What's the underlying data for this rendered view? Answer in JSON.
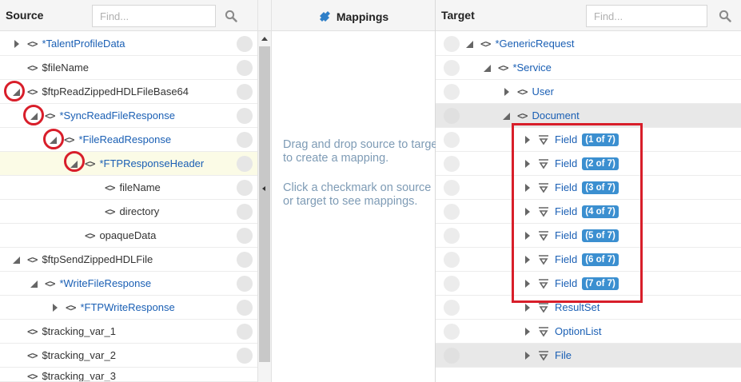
{
  "source": {
    "title": "Source",
    "find_placeholder": "Find...",
    "rows": [
      {
        "label": "TalentProfileData",
        "required": true,
        "expander": "right"
      },
      {
        "label": "$fileName",
        "required": false,
        "expander": "none"
      },
      {
        "label": "$ftpReadZippedHDLFileBase64",
        "required": false,
        "expander": "down"
      },
      {
        "label": "SyncReadFileResponse",
        "required": true,
        "expander": "down"
      },
      {
        "label": "FileReadResponse",
        "required": true,
        "expander": "down"
      },
      {
        "label": "FTPResponseHeader",
        "required": true,
        "expander": "down"
      },
      {
        "label": "fileName",
        "required": false,
        "expander": "none"
      },
      {
        "label": "directory",
        "required": false,
        "expander": "none"
      },
      {
        "label": "opaqueData",
        "required": false,
        "expander": "none"
      },
      {
        "label": "$ftpSendZippedHDLFile",
        "required": false,
        "expander": "down"
      },
      {
        "label": "WriteFileResponse",
        "required": true,
        "expander": "down"
      },
      {
        "label": "FTPWriteResponse",
        "required": true,
        "expander": "right"
      },
      {
        "label": "$tracking_var_1",
        "required": false,
        "expander": "none"
      },
      {
        "label": "$tracking_var_2",
        "required": false,
        "expander": "none"
      },
      {
        "label": "$tracking_var_3",
        "required": false,
        "expander": "none"
      }
    ]
  },
  "mappings": {
    "title": "Mappings",
    "hint1": "Drag and drop source to target to create a mapping.",
    "hint2": "Click a checkmark on source or target to see mappings."
  },
  "target": {
    "title": "Target",
    "find_placeholder": "Find...",
    "rows": [
      {
        "label": "GenericRequest",
        "required": true,
        "expander": "down"
      },
      {
        "label": "Service",
        "required": true,
        "expander": "down"
      },
      {
        "label": "User",
        "required": false,
        "expander": "right"
      },
      {
        "label": "Document",
        "required": false,
        "expander": "down"
      },
      {
        "label": "Field",
        "badge": "1 of 7"
      },
      {
        "label": "Field",
        "badge": "2 of 7"
      },
      {
        "label": "Field",
        "badge": "3 of 7"
      },
      {
        "label": "Field",
        "badge": "4 of 7"
      },
      {
        "label": "Field",
        "badge": "5 of 7"
      },
      {
        "label": "Field",
        "badge": "6 of 7"
      },
      {
        "label": "Field",
        "badge": "7 of 7"
      },
      {
        "label": "ResultSet"
      },
      {
        "label": "OptionList"
      },
      {
        "label": "File"
      }
    ]
  },
  "colors": {
    "annotation_red": "#d81e2a",
    "badge_blue": "#3b8fd0",
    "link_blue": "#1a5fb4",
    "hint_text": "#7e9bb5"
  },
  "icons": {
    "search": "search-icon",
    "element": "element-icon",
    "field": "field-icon",
    "mappings": "puzzle-icon"
  }
}
